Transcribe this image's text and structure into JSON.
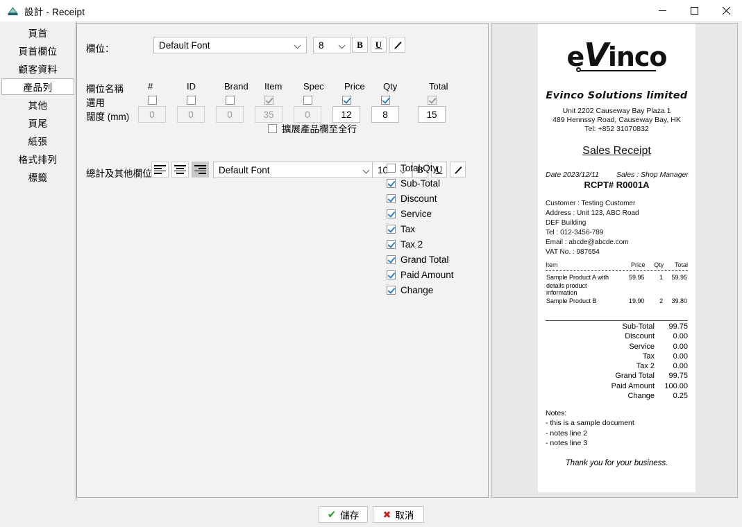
{
  "window": {
    "title": "設計 - Receipt",
    "icon": "app-printer-icon",
    "minimize_label": "—",
    "maximize_label": "□",
    "close_label": "✕"
  },
  "sidebar": {
    "items": [
      {
        "label": "頁首",
        "selected": false
      },
      {
        "label": "頁首欄位",
        "selected": false
      },
      {
        "label": "顧客資料",
        "selected": false
      },
      {
        "label": "產品列",
        "selected": true
      },
      {
        "label": "其他",
        "selected": false
      },
      {
        "label": "頁尾",
        "selected": false
      },
      {
        "label": "紙張",
        "selected": false
      },
      {
        "label": "格式排列",
        "selected": false
      },
      {
        "label": "標籤",
        "selected": false
      }
    ]
  },
  "settings": {
    "field_label": "欄位：",
    "field_font": "Default Font",
    "field_size": "8",
    "bold_label": "B",
    "underline_label": "U",
    "color_label": "✎",
    "row_name_label": "欄位名稱",
    "row_enabled_label": "選用",
    "row_width_label": "闊度 (mm)",
    "columns": [
      {
        "name": "#",
        "checked": false,
        "disabled": false,
        "width": "0",
        "width_disabled": true
      },
      {
        "name": "ID",
        "checked": false,
        "disabled": false,
        "width": "0",
        "width_disabled": true
      },
      {
        "name": "Brand",
        "checked": false,
        "disabled": false,
        "width": "0",
        "width_disabled": true
      },
      {
        "name": "Item",
        "checked": true,
        "disabled": true,
        "width": "35",
        "width_disabled": true
      },
      {
        "name": "Spec",
        "checked": false,
        "disabled": false,
        "width": "0",
        "width_disabled": true
      },
      {
        "name": "Price",
        "checked": true,
        "disabled": false,
        "width": "12",
        "width_disabled": false
      },
      {
        "name": "Qty",
        "checked": true,
        "disabled": false,
        "width": "8",
        "width_disabled": false
      },
      {
        "name": "Total",
        "checked": true,
        "disabled": true,
        "width": "15",
        "width_disabled": false
      }
    ],
    "expand_item_label": "擴展產品欄至全行",
    "expand_item_checked": false,
    "totals_label": "總計及其他欄位：",
    "align_left": "align-left",
    "align_center": "align-center",
    "align_right": "align-right",
    "align_selected": "align-right",
    "totals_font": "Default Font",
    "totals_size": "10",
    "total_fields": [
      {
        "label": "Total Qty",
        "checked": false
      },
      {
        "label": "Sub-Total",
        "checked": true
      },
      {
        "label": "Discount",
        "checked": true
      },
      {
        "label": "Service",
        "checked": true
      },
      {
        "label": "Tax",
        "checked": true
      },
      {
        "label": "Tax 2",
        "checked": true
      },
      {
        "label": "Grand Total",
        "checked": true
      },
      {
        "label": "Paid Amount",
        "checked": true
      },
      {
        "label": "Change",
        "checked": true
      }
    ]
  },
  "receipt": {
    "logo_pre": "e",
    "logo_v": "V",
    "logo_post": "inco",
    "company": "Evinco Solutions limited",
    "address_line1": "Unit 2202 Causeway Bay Plaza 1",
    "address_line2": "489 Hennssy Road, Causeway Bay, HK",
    "address_line3": "Tel: +852 31070832",
    "doc_title": "Sales Receipt",
    "date_text": "Date 2023/12/11",
    "sales_text": "Sales : Shop Manager",
    "rcpt_no": "RCPT# R0001A",
    "customer_lines": [
      "Customer : Testing Customer",
      "Address : Unit 123, ABC Road",
      "DEF Building",
      "Tel : 012-3456-789",
      "Email : abcde@abcde.com",
      "VAT No. : 987654"
    ],
    "table_headers": [
      "Item",
      "Price",
      "Qty",
      "Total"
    ],
    "items": [
      {
        "name": "Sample Product A with",
        "name2": "details product information",
        "price": "59.95",
        "qty": "1",
        "total": "59.95"
      },
      {
        "name": "Sample Product B",
        "name2": "",
        "price": "19.90",
        "qty": "2",
        "total": "39.80"
      }
    ],
    "totals": [
      {
        "label": "Sub-Total",
        "value": "99.75"
      },
      {
        "label": "Discount",
        "value": "0.00"
      },
      {
        "label": "Service",
        "value": "0.00"
      },
      {
        "label": "Tax",
        "value": "0.00"
      },
      {
        "label": "Tax 2",
        "value": "0.00"
      },
      {
        "label": "Grand Total",
        "value": "99.75"
      },
      {
        "label": "Paid Amount",
        "value": "100.00"
      },
      {
        "label": "Change",
        "value": "0.25"
      }
    ],
    "notes_title": "Notes:",
    "notes": [
      "- this is a sample document",
      "- notes line 2",
      "- notes line 3"
    ],
    "thanks": "Thank you for your business."
  },
  "footer": {
    "save_label": "儲存",
    "cancel_label": "取消",
    "save_icon": "check-icon",
    "cancel_icon": "cross-icon"
  },
  "colors": {
    "accent_check": "#2a7fd4",
    "save_green": "#2d9c36",
    "cancel_red": "#cc2222",
    "panel_bg": "#f2f2f2",
    "preview_bg": "#e8e8e8"
  }
}
